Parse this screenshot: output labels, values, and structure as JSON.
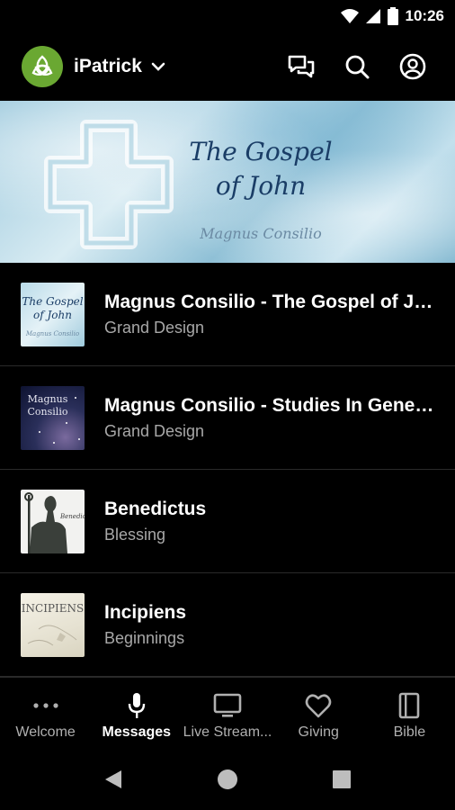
{
  "status_bar": {
    "time": "10:26"
  },
  "app_bar": {
    "name": "iPatrick"
  },
  "banner": {
    "title_line1": "The Gospel",
    "title_line2": "of John",
    "subtitle": "Magnus Consilio"
  },
  "thumbs": {
    "gospel": {
      "title_line1": "The Gospel",
      "title_line2": "of John",
      "subtitle": "Magnus Consilio"
    },
    "studies": {
      "title_line1": "Magnus",
      "title_line2": "Consilio"
    },
    "benedictus": {
      "label": "Benedictus"
    },
    "incipiens": {
      "label": "INCIPIENS"
    }
  },
  "series": [
    {
      "title": "Magnus Consilio - The Gospel of John",
      "subtitle": "Grand Design"
    },
    {
      "title": "Magnus Consilio - Studies In Genesis",
      "subtitle": "Grand Design"
    },
    {
      "title": "Benedictus",
      "subtitle": "Blessing"
    },
    {
      "title": "Incipiens",
      "subtitle": "Beginnings"
    }
  ],
  "bottom_nav": [
    {
      "label": "Welcome",
      "icon": "more-dots-icon"
    },
    {
      "label": "Messages",
      "icon": "microphone-icon",
      "active": true
    },
    {
      "label": "Live Stream...",
      "icon": "tv-icon"
    },
    {
      "label": "Giving",
      "icon": "heart-icon"
    },
    {
      "label": "Bible",
      "icon": "book-icon"
    }
  ],
  "colors": {
    "brand_green": "#6aa832",
    "background": "#000000",
    "muted_text": "#a8a8a8"
  }
}
